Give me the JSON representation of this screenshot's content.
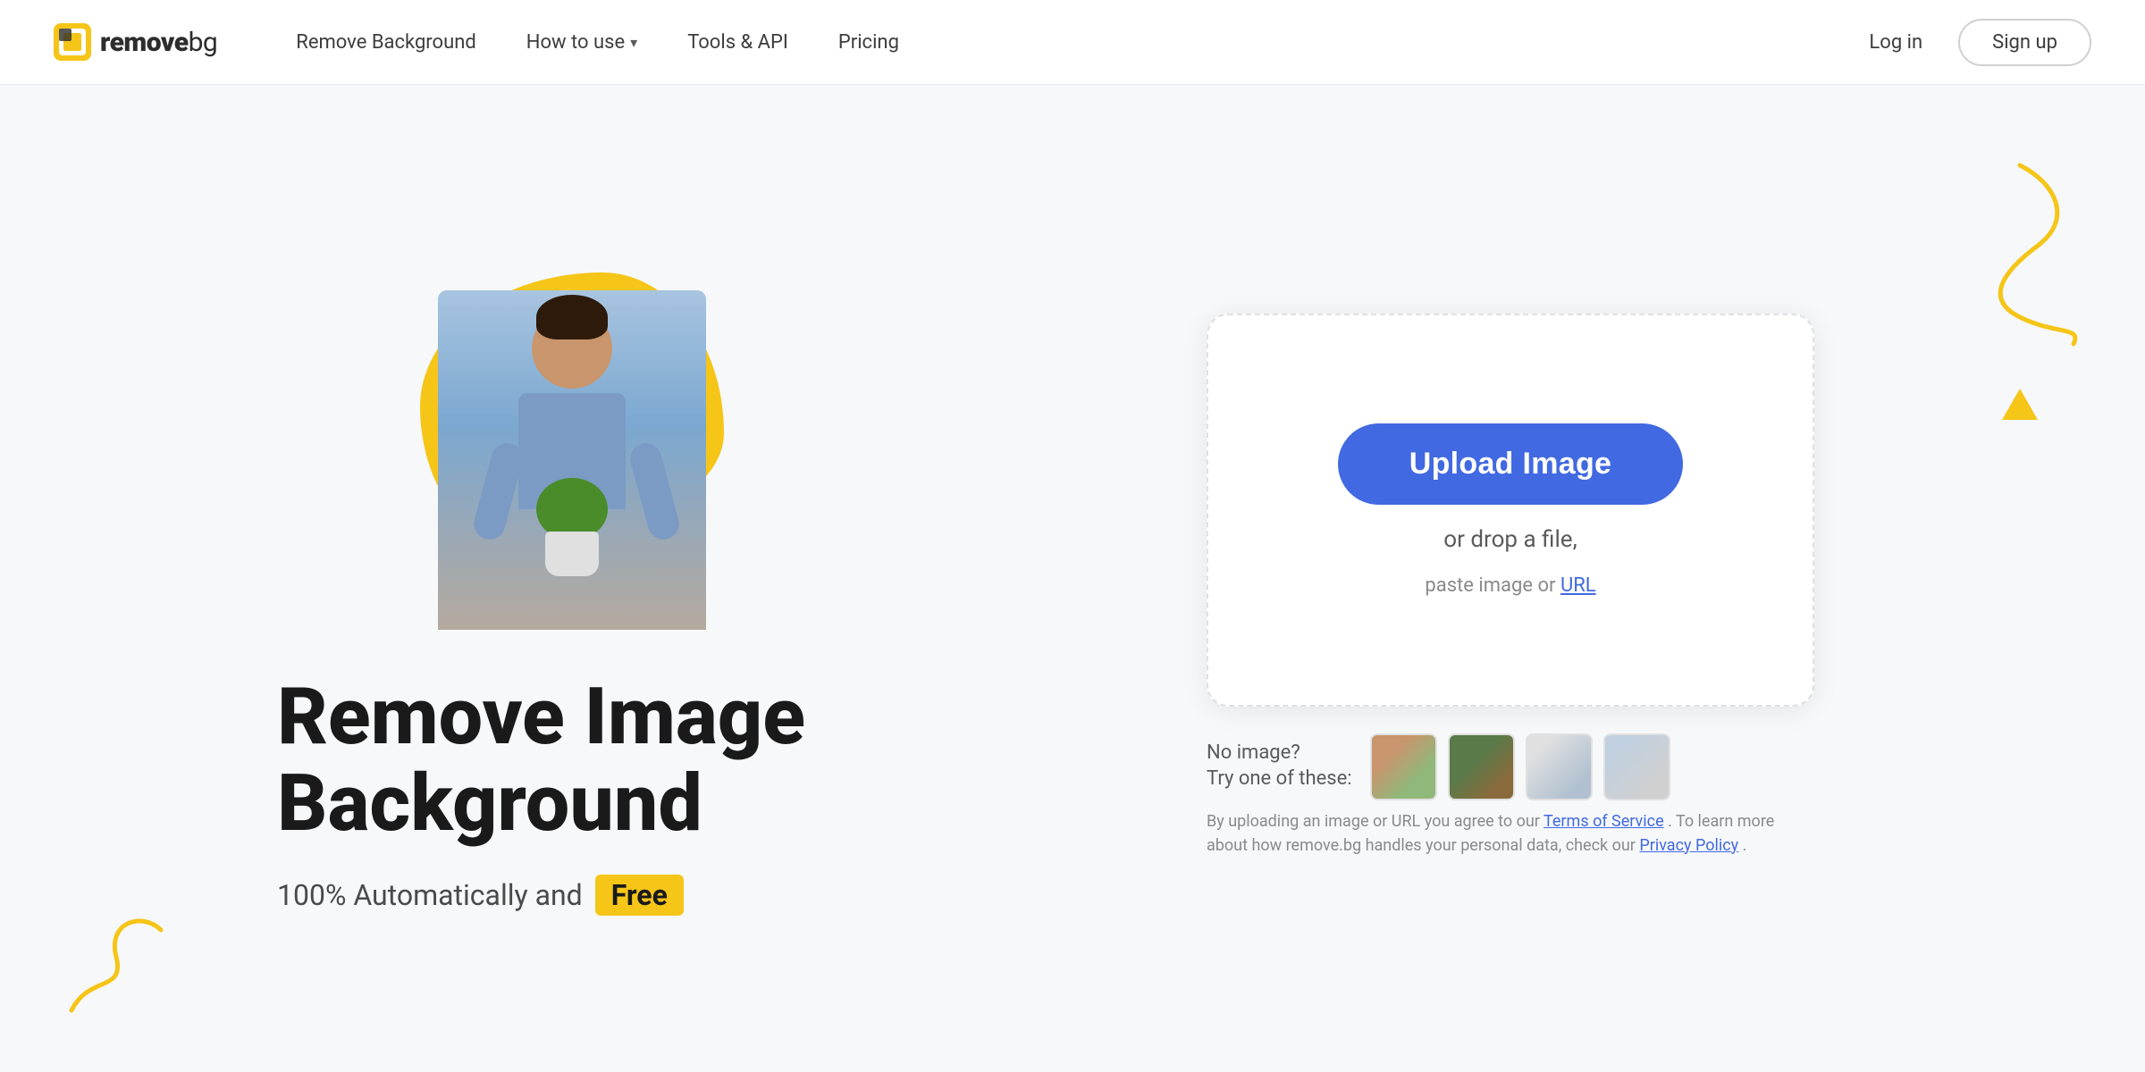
{
  "brand": {
    "name_remove": "remove",
    "name_bg": "bg",
    "logo_alt": "remove.bg logo"
  },
  "nav": {
    "links": [
      {
        "id": "remove-background",
        "label": "Remove Background",
        "has_dropdown": false
      },
      {
        "id": "how-to-use",
        "label": "How to use",
        "has_dropdown": true
      },
      {
        "id": "tools-api",
        "label": "Tools & API",
        "has_dropdown": false
      },
      {
        "id": "pricing",
        "label": "Pricing",
        "has_dropdown": false
      }
    ],
    "login_label": "Log in",
    "signup_label": "Sign up"
  },
  "hero": {
    "title_line1": "Remove Image",
    "title_line2": "Background",
    "subtitle_prefix": "100% Automatically and",
    "free_badge": "Free",
    "upload_button": "Upload Image",
    "drop_text": "or drop a file,",
    "paste_text_prefix": "paste image or",
    "paste_link": "URL",
    "no_image_label": "No image?\nTry one of these:",
    "terms_prefix": "By uploading an image or URL you agree to our",
    "terms_link": "Terms of Service",
    "terms_middle": ". To learn more about how remove.bg handles your personal data, check our",
    "privacy_link": "Privacy Policy",
    "terms_suffix": "."
  },
  "decorations": {
    "accent_color": "#f5c518",
    "upload_btn_color": "#4169e1"
  }
}
